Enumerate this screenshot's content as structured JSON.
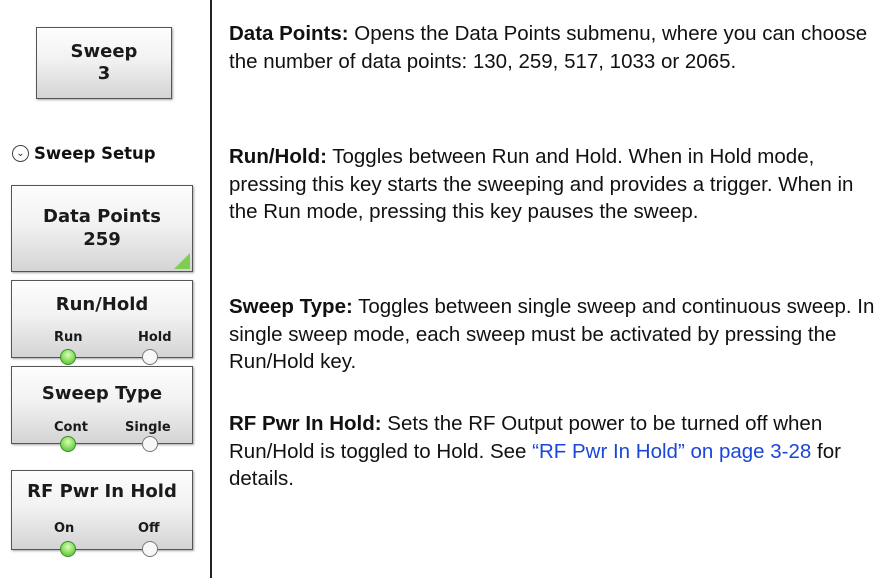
{
  "keys": {
    "sweep": {
      "line1": "Sweep",
      "line2": "3"
    },
    "section": {
      "label": "Sweep Setup",
      "icon": "chevron-down-icon"
    },
    "data_points": {
      "line1": "Data Points",
      "line2": "259"
    },
    "run_hold": {
      "title": "Run/Hold",
      "left": "Run",
      "right": "Hold",
      "active": "Run"
    },
    "sweep_type": {
      "title": "Sweep Type",
      "left": "Cont",
      "right": "Single",
      "active": "Cont"
    },
    "rf_pwr": {
      "title": "RF Pwr In Hold",
      "left": "On",
      "right": "Off",
      "active": "On"
    }
  },
  "descriptions": [
    {
      "term": "Data Points:",
      "text": " Opens the Data Points submenu, where you can choose the number of data points: 130, 259, 517, 1033 or 2065."
    },
    {
      "term": "Run/Hold:",
      "text": " Toggles between Run and Hold. When in Hold mode, pressing this key starts the sweeping and provides a trigger. When in the Run mode, pressing this key pauses the sweep."
    },
    {
      "term": "Sweep Type:",
      "text": " Toggles between single sweep and continuous sweep. In single sweep mode, each sweep must be activated by pressing the Run/Hold key."
    },
    {
      "term": "RF Pwr In Hold:",
      "text": " Sets the RF Output power to be turned off when Run/Hold is toggled to Hold. See ",
      "link": "“RF Pwr In Hold” on page 3-28",
      "tail": " for details."
    }
  ],
  "colors": {
    "led_on": "#6ed04a",
    "link": "#1a47d8",
    "corner_accent": "#7ccf52"
  }
}
